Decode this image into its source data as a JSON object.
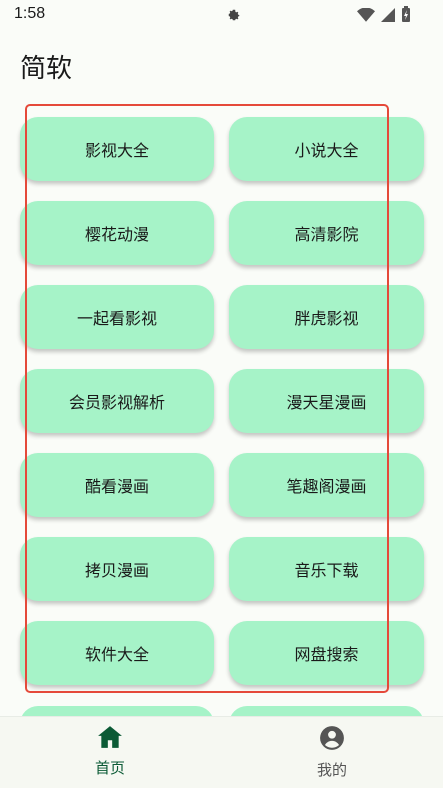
{
  "status_bar": {
    "time": "1:58",
    "icons": [
      "gear-icon",
      "wifi-icon",
      "signal-icon",
      "battery-charging-icon"
    ]
  },
  "header": {
    "title": "简软"
  },
  "menu": {
    "items": [
      {
        "label": "影视大全"
      },
      {
        "label": "小说大全"
      },
      {
        "label": "樱花动漫"
      },
      {
        "label": "高清影院"
      },
      {
        "label": "一起看影视"
      },
      {
        "label": "胖虎影视"
      },
      {
        "label": "会员影视解析"
      },
      {
        "label": "漫天星漫画"
      },
      {
        "label": "酷看漫画"
      },
      {
        "label": "笔趣阁漫画"
      },
      {
        "label": "拷贝漫画"
      },
      {
        "label": "音乐下载"
      },
      {
        "label": "软件大全"
      },
      {
        "label": "网盘搜索"
      }
    ]
  },
  "bottom_nav": {
    "home_label": "首页",
    "home_icon": "home-icon",
    "mine_label": "我的",
    "mine_icon": "account-circle-icon"
  },
  "colors": {
    "card_background": "#a6f3c8",
    "active_nav": "#0b5a35",
    "selection_outline": "#e5493a"
  }
}
